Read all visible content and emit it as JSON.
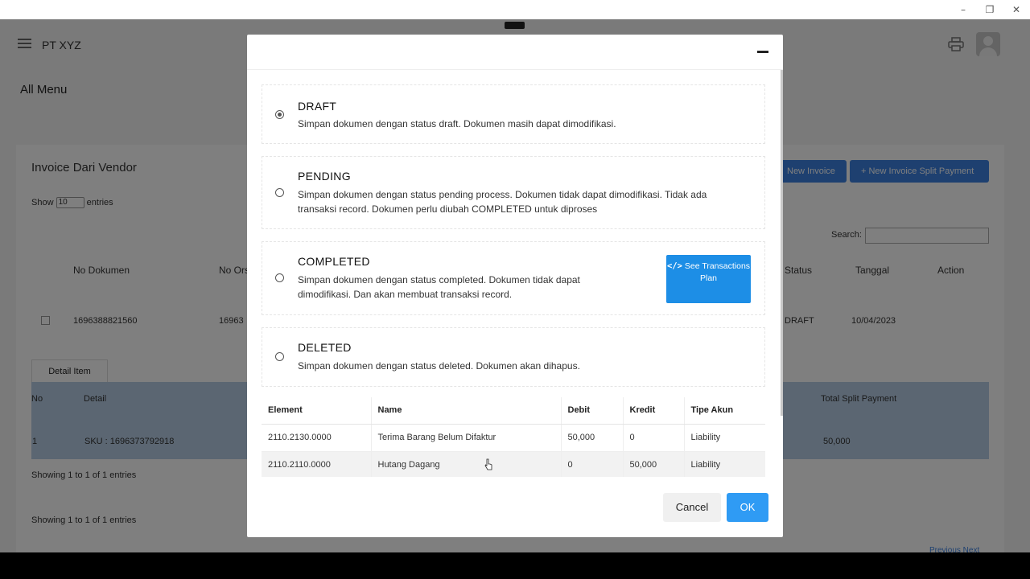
{
  "window": {
    "minimize": "–",
    "restore": "❐",
    "close": "✕"
  },
  "app": {
    "brand": "PT XYZ",
    "section_title": "All Menu",
    "panel_title": "Invoice Dari Vendor",
    "new_invoice": "New Invoice",
    "new_invoice_split": "+ New Invoice Split Payment",
    "show_label": "Show",
    "show_value": "10",
    "entries_label": "entries",
    "search_label": "Search:",
    "columns": {
      "no_dokumen": "No Dokumen",
      "no_ors": "No Ors",
      "status": "Status",
      "tanggal": "Tanggal",
      "action": "Action"
    },
    "row": {
      "no_dokumen": "1696388821560",
      "no_ors": "16963",
      "status": "DRAFT",
      "tanggal": "10/04/2023"
    },
    "detail_tab": "Detail Item",
    "detail_columns": {
      "no": "No",
      "detail": "Detail",
      "total_split": "Total Split Payment"
    },
    "detail_row": {
      "no": "1",
      "detail": "SKU : 1696373792918",
      "total_split": "50,000"
    },
    "showing_1": "Showing 1 to 1 of 1 entries",
    "showing_2": "Showing 1 to 1 of 1 entries",
    "pager": "Previous Next"
  },
  "modal": {
    "options": [
      {
        "title": "DRAFT",
        "desc": "Simpan dokumen dengan status draft. Dokumen masih dapat dimodifikasi.",
        "checked": true
      },
      {
        "title": "PENDING",
        "desc": "Simpan dokumen dengan status pending process. Dokumen tidak dapat dimodifikasi. Tidak ada transaksi record. Dokumen perlu diubah COMPLETED untuk diproses",
        "checked": false
      },
      {
        "title": "COMPLETED",
        "desc": "Simpan dokumen dengan status completed. Dokumen tidak dapat dimodifikasi. Dan akan membuat transaksi record.",
        "checked": false
      },
      {
        "title": "DELETED",
        "desc": "Simpan dokumen dengan status deleted. Dokumen akan dihapus.",
        "checked": false
      }
    ],
    "see_button": {
      "icon": "</>",
      "label": "See Transactions Plan"
    },
    "table": {
      "headers": [
        "Element",
        "Name",
        "Debit",
        "Kredit",
        "Tipe Akun"
      ],
      "rows": [
        [
          "2110.2130.0000",
          "Terima Barang Belum Difaktur",
          "50,000",
          "0",
          "Liability"
        ],
        [
          "2110.2110.0000",
          "Hutang Dagang",
          "0",
          "50,000",
          "Liability"
        ]
      ]
    },
    "cancel": "Cancel",
    "ok": "OK"
  }
}
